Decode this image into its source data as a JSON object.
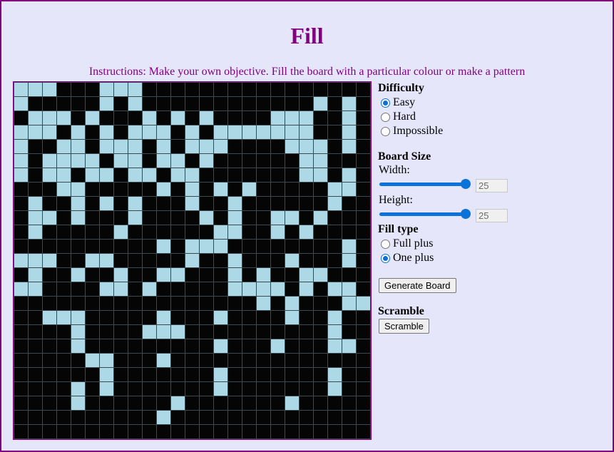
{
  "title": "Fill",
  "instructions": "Instructions: Make your own objective. Fill the board with a particular colour or make a pattern",
  "colors": {
    "filled": "#add8e6",
    "empty": "#050505",
    "grid_line": "#3a4a4f",
    "accent": "#800080"
  },
  "board": {
    "rows": [
      "1110001110000000000000000",
      "1000001010000000000001010",
      "0111010001010100001110010",
      "1110101011101011111110010",
      "1001101110101110000111010",
      "1011110110110100000011000",
      "1011011011011000000011010",
      "0001100000101010100000110",
      "0100101010001001000000100",
      "0110100010000101001101000",
      "0100000100000011001010000",
      "0000000000101110000000010",
      "1110011000001001000100010",
      "0100100100110001010011000",
      "1100001101000001111010110",
      "0000000000000000010100011",
      "0011100000100010000100100",
      "0000100001110000000000100",
      "0000100000000010001000110",
      "0000011000100000000000000",
      "0000001000000010000000100",
      "0000101000000010000000100",
      "0000100000010000000100000",
      "0000000000100000000000000",
      "0000000000000000000000000"
    ]
  },
  "difficulty": {
    "heading": "Difficulty",
    "options": [
      {
        "label": "Easy",
        "checked": true
      },
      {
        "label": "Hard",
        "checked": false
      },
      {
        "label": "Impossible",
        "checked": false
      }
    ]
  },
  "board_size": {
    "heading": "Board Size",
    "width_label": "Width:",
    "width_value": "25",
    "width_slider_fraction": 1.0,
    "height_label": "Height:",
    "height_value": "25",
    "height_slider_fraction": 1.0
  },
  "fill_type": {
    "heading": "Fill type",
    "options": [
      {
        "label": "Full plus",
        "checked": false
      },
      {
        "label": "One plus",
        "checked": true
      }
    ]
  },
  "generate_button": "Generate Board",
  "scramble": {
    "heading": "Scramble",
    "button": "Scramble"
  }
}
